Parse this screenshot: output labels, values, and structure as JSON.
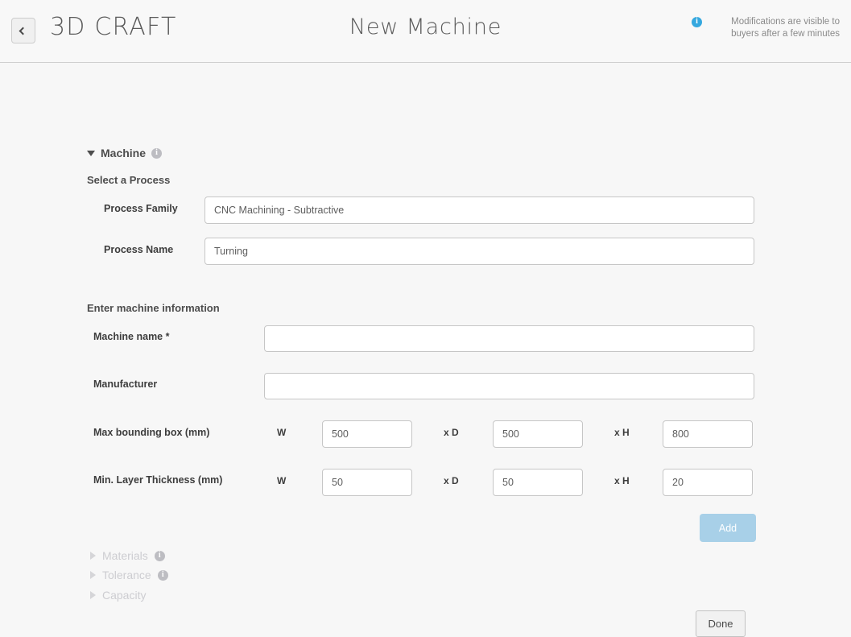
{
  "header": {
    "back_icon": "chevron-left-icon",
    "brand": "3D CRAFT",
    "title": "New Machine",
    "notice_icon": "info-icon",
    "notice_text": "Modifications are visible to buyers after a few minutes"
  },
  "colors": {
    "page_bg": "#f7f7f7",
    "header_bg": "#f8f8f8",
    "info_blue": "#35a8df",
    "info_gray": "#bdbdc2",
    "add_button": "#a8d0e8",
    "text": "#3b3b3b",
    "muted_text": "#cdcdd1",
    "field_border": "#c6c6c6"
  },
  "machine_section": {
    "label": "Machine",
    "expanded": true,
    "toggle_icon": "triangle-down-icon",
    "info_icon": "info-icon",
    "process_group_label": "Select a Process",
    "process_family": {
      "label": "Process Family",
      "value": "CNC Machining - Subtractive",
      "placeholder": ""
    },
    "process_name": {
      "label": "Process Name",
      "value": "Turning",
      "placeholder": ""
    },
    "machine_info_group_label": "Enter machine information",
    "machine_name": {
      "label": "Machine name *",
      "value": "",
      "placeholder": ""
    },
    "manufacturer": {
      "label": "Manufacturer",
      "value": "",
      "placeholder": ""
    },
    "max_bounding_box": {
      "label": "Max bounding box (mm)",
      "w_label": "W",
      "w_value": "500",
      "d_label": "x D",
      "d_value": "500",
      "h_label": "x H",
      "h_value": "800"
    },
    "min_layer_thickness": {
      "label": "Min. Layer Thickness (mm)",
      "w_label": "W",
      "w_value": "50",
      "d_label": "x D",
      "d_value": "50",
      "h_label": "x H",
      "h_value": "20"
    },
    "add_button_label": "Add"
  },
  "collapsed_sections": [
    {
      "label": "Materials",
      "toggle_icon": "triangle-right-icon",
      "has_info": true,
      "info_icon": "info-icon"
    },
    {
      "label": "Tolerance",
      "toggle_icon": "triangle-right-icon",
      "has_info": true,
      "info_icon": "info-icon"
    },
    {
      "label": "Capacity",
      "toggle_icon": "triangle-right-icon",
      "has_info": false,
      "info_icon": ""
    }
  ],
  "footer": {
    "done_label": "Done"
  }
}
